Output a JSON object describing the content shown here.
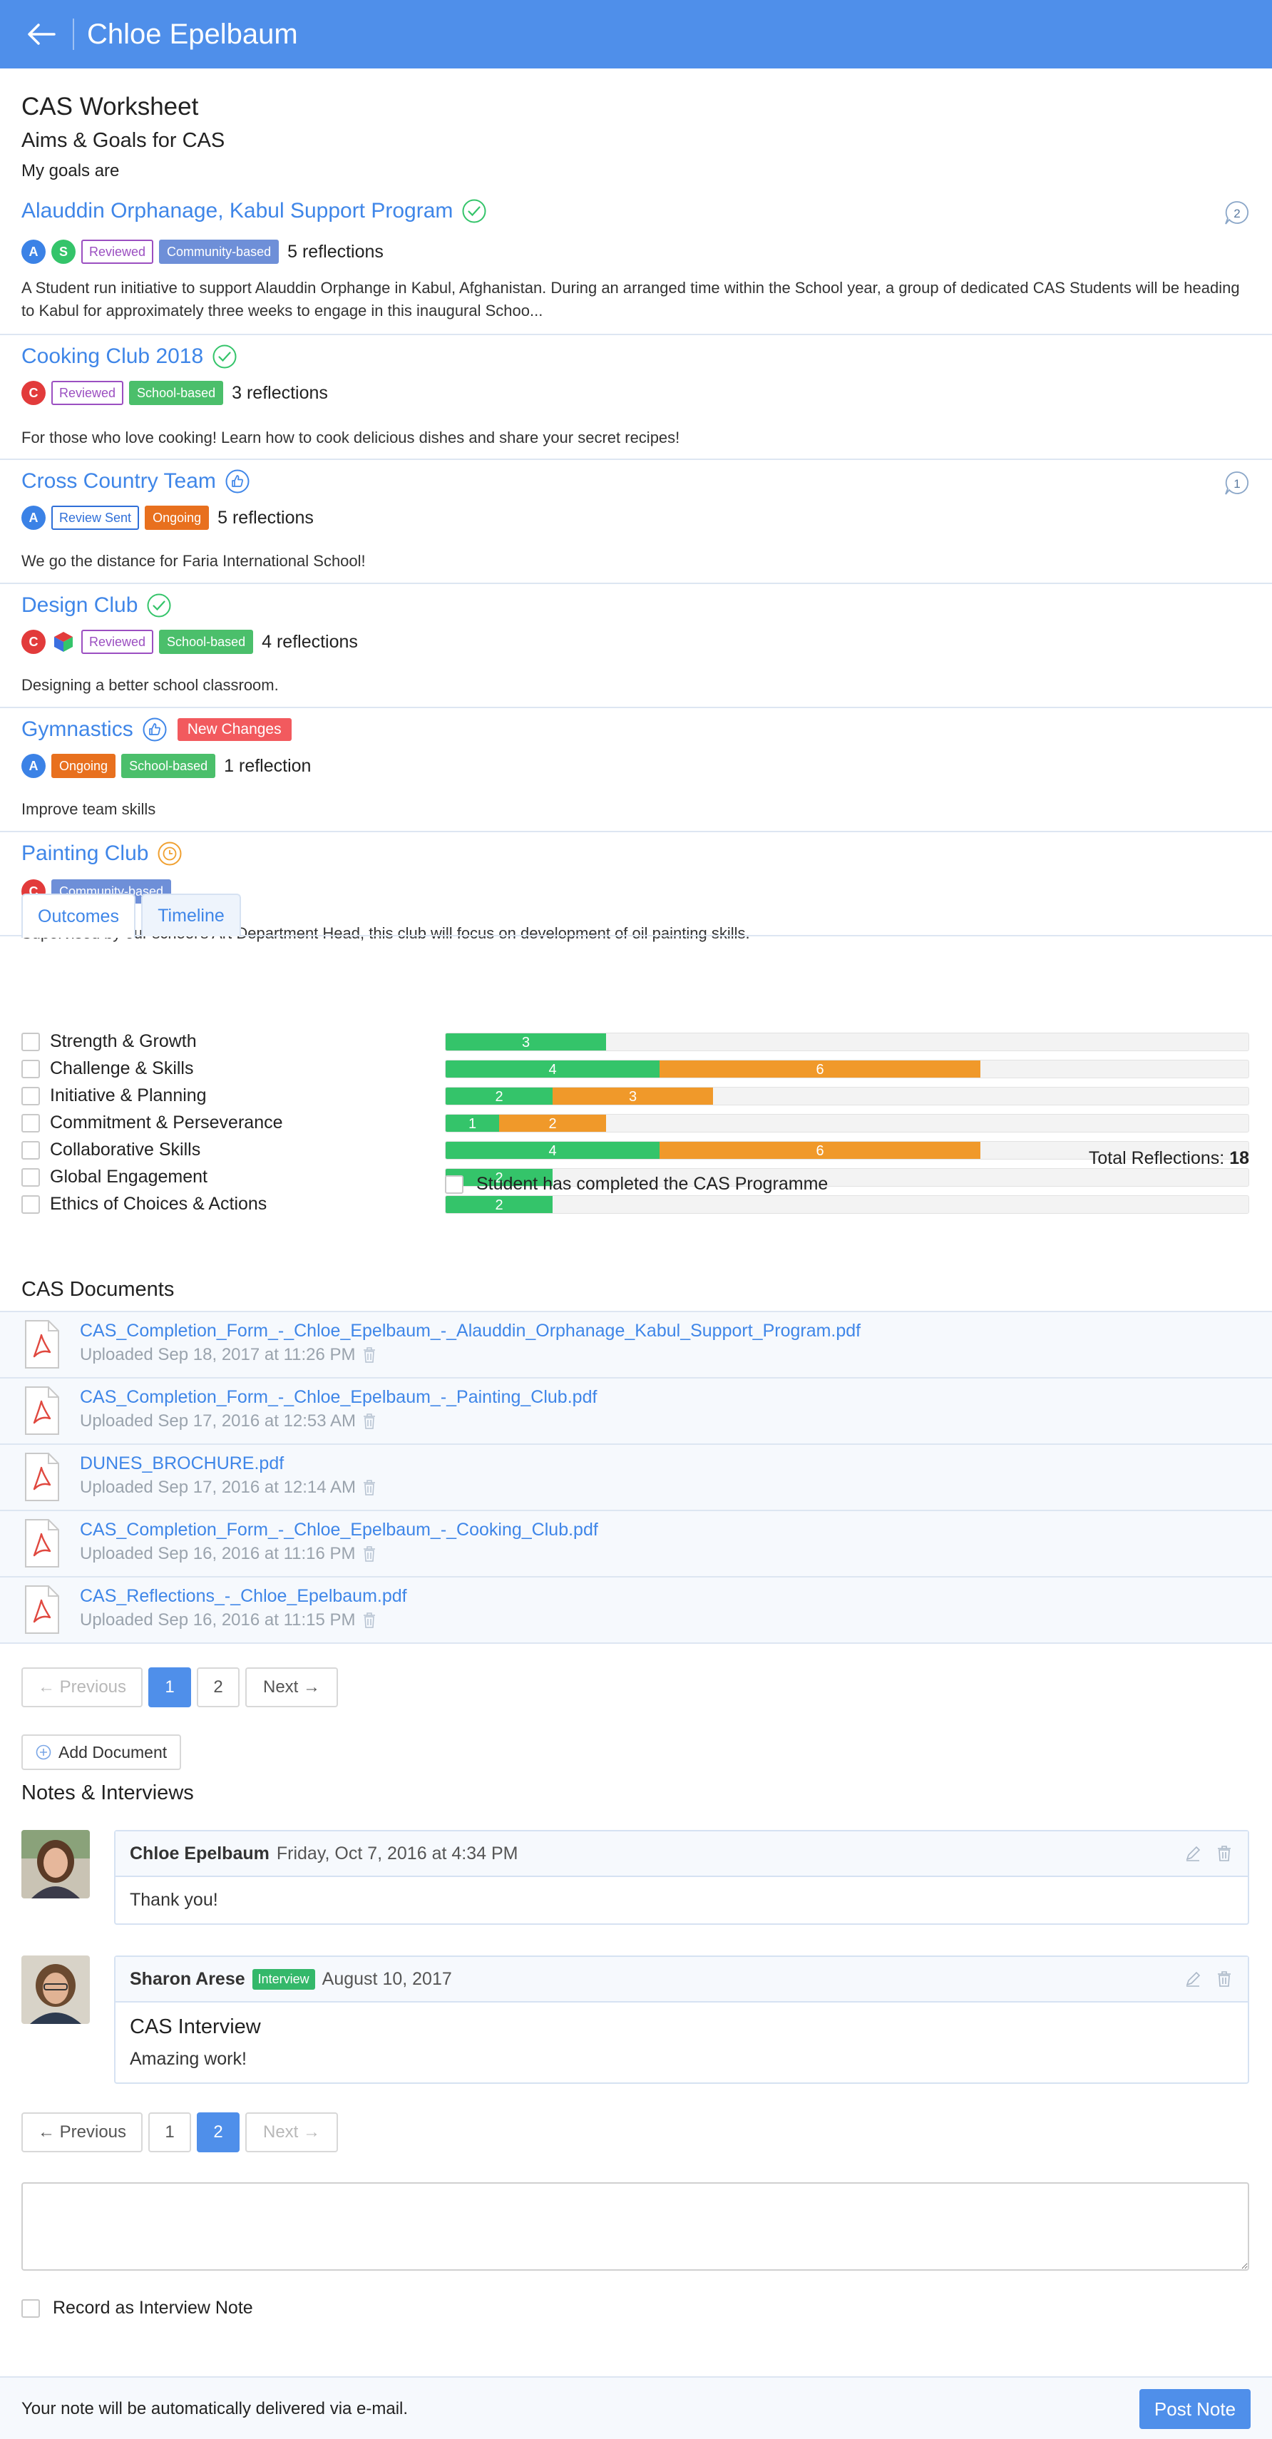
{
  "header": {
    "title": "Chloe Epelbaum"
  },
  "worksheet": {
    "title": "CAS Worksheet",
    "aims_title": "Aims & Goals for CAS",
    "goals_label": "My goals are"
  },
  "activities": [
    {
      "title": "Alauddin Orphanage, Kabul Support Program",
      "status": "completed",
      "avatars": [
        {
          "letter": "A",
          "color": "#3b82e6"
        },
        {
          "letter": "S",
          "color": "#34c46a"
        }
      ],
      "tags": [
        {
          "label": "Reviewed",
          "kind": "reviewed"
        },
        {
          "label": "Community-based",
          "kind": "community"
        }
      ],
      "reflections": "5 reflections",
      "description": "A Student run initiative to support Alauddin Orphange in Kabul, Afghanistan. During an arranged time within the School year, a group of dedicated CAS Students will be heading to Kabul for approximately three weeks to engage in this inaugural Schoo...",
      "comments": "2"
    },
    {
      "title": "Cooking Club 2018",
      "status": "completed",
      "avatars": [
        {
          "letter": "C",
          "color": "#e23b3b"
        }
      ],
      "tags": [
        {
          "label": "Reviewed",
          "kind": "reviewed"
        },
        {
          "label": "School-based",
          "kind": "school"
        }
      ],
      "reflections": "3 reflections",
      "description": "For those who love cooking! Learn how to cook delicious dishes and share your secret recipes!"
    },
    {
      "title": "Cross Country Team",
      "status": "approved",
      "avatars": [
        {
          "letter": "A",
          "color": "#3b82e6"
        }
      ],
      "tags": [
        {
          "label": "Review Sent",
          "kind": "reviewsent"
        },
        {
          "label": "Ongoing",
          "kind": "ongoing"
        }
      ],
      "reflections": "5 reflections",
      "description": "We go the distance for Faria International School!",
      "comments": "1"
    },
    {
      "title": "Design Club",
      "status": "completed",
      "avatars": [
        {
          "letter": "C",
          "color": "#e23b3b"
        }
      ],
      "tags": [
        {
          "label": "Reviewed",
          "kind": "reviewed"
        },
        {
          "label": "School-based",
          "kind": "school"
        }
      ],
      "reflections": "4 reflections",
      "description": "Designing a better school classroom."
    },
    {
      "title": "Gymnastics",
      "status": "approved",
      "new_changes": "New Changes",
      "avatars": [
        {
          "letter": "A",
          "color": "#3b82e6"
        }
      ],
      "tags": [
        {
          "label": "Ongoing",
          "kind": "ongoing"
        },
        {
          "label": "School-based",
          "kind": "school"
        }
      ],
      "reflections": "1 reflection",
      "description": "Improve team skills"
    },
    {
      "title": "Painting Club",
      "status": "pending",
      "avatars": [
        {
          "letter": "C",
          "color": "#e23b3b"
        }
      ],
      "tags": [
        {
          "label": "Community-based",
          "kind": "community"
        }
      ],
      "reflections": "",
      "description": "Supervised by our school's Art Department Head, this club will focus on development of oil painting skills."
    }
  ],
  "tabs": {
    "outcomes": "Outcomes",
    "timeline": "Timeline"
  },
  "outcomes": [
    {
      "label": "Strength & Growth",
      "green": 3,
      "orange": 0
    },
    {
      "label": "Challenge & Skills",
      "green": 4,
      "orange": 6
    },
    {
      "label": "Initiative & Planning",
      "green": 2,
      "orange": 3
    },
    {
      "label": "Commitment & Perseverance",
      "green": 1,
      "orange": 2
    },
    {
      "label": "Collaborative Skills",
      "green": 4,
      "orange": 6
    },
    {
      "label": "Global Engagement",
      "green": 2,
      "orange": 0
    },
    {
      "label": "Ethics of Choices & Actions",
      "green": 2,
      "orange": 0
    }
  ],
  "outcomes_scale_max": 15,
  "total_reflections_label": "Total Reflections:",
  "total_reflections": "18",
  "cas_complete_label": "Student has completed the CAS Programme",
  "documents_title": "CAS Documents",
  "documents": [
    {
      "name": "CAS_Completion_Form_-_Chloe_Epelbaum_-_Alauddin_Orphanage_Kabul_Support_Program.pdf",
      "uploaded": "Uploaded Sep 18, 2017 at 11:26 PM"
    },
    {
      "name": "CAS_Completion_Form_-_Chloe_Epelbaum_-_Painting_Club.pdf",
      "uploaded": "Uploaded Sep 17, 2016 at 12:53 AM"
    },
    {
      "name": "DUNES_BROCHURE.pdf",
      "uploaded": "Uploaded Sep 17, 2016 at 12:14 AM"
    },
    {
      "name": "CAS_Completion_Form_-_Chloe_Epelbaum_-_Cooking_Club.pdf",
      "uploaded": "Uploaded Sep 16, 2016 at 11:16 PM"
    },
    {
      "name": "CAS_Reflections_-_Chloe_Epelbaum.pdf",
      "uploaded": "Uploaded Sep 16, 2016 at 11:15 PM"
    }
  ],
  "doc_pager": {
    "previous": "← Previous",
    "page1": "1",
    "page2": "2",
    "next": "Next →",
    "active": 1
  },
  "add_document_label": "Add Document",
  "notes_title": "Notes & Interviews",
  "notes": [
    {
      "author": "Chloe Epelbaum",
      "date": "Friday, Oct 7, 2016 at 4:34 PM",
      "body": "Thank you!"
    },
    {
      "author": "Sharon Arese",
      "tag": "Interview",
      "date": "August 10, 2017",
      "title": "CAS Interview",
      "body": "Amazing work!"
    }
  ],
  "notes_pager": {
    "previous": "← Previous",
    "page1": "1",
    "page2": "2",
    "next": "Next →",
    "active": 2
  },
  "note_input": {
    "value": "",
    "placeholder": ""
  },
  "record_interview_label": "Record as Interview Note",
  "footer": {
    "text": "Your note will be automatically delivered via e-mail.",
    "post_label": "Post Note"
  },
  "colors": {
    "accent": "#4f8fea",
    "link": "#3f86e8",
    "green": "#34c46a",
    "orange": "#f0992a",
    "danger": "#f25a5e"
  }
}
